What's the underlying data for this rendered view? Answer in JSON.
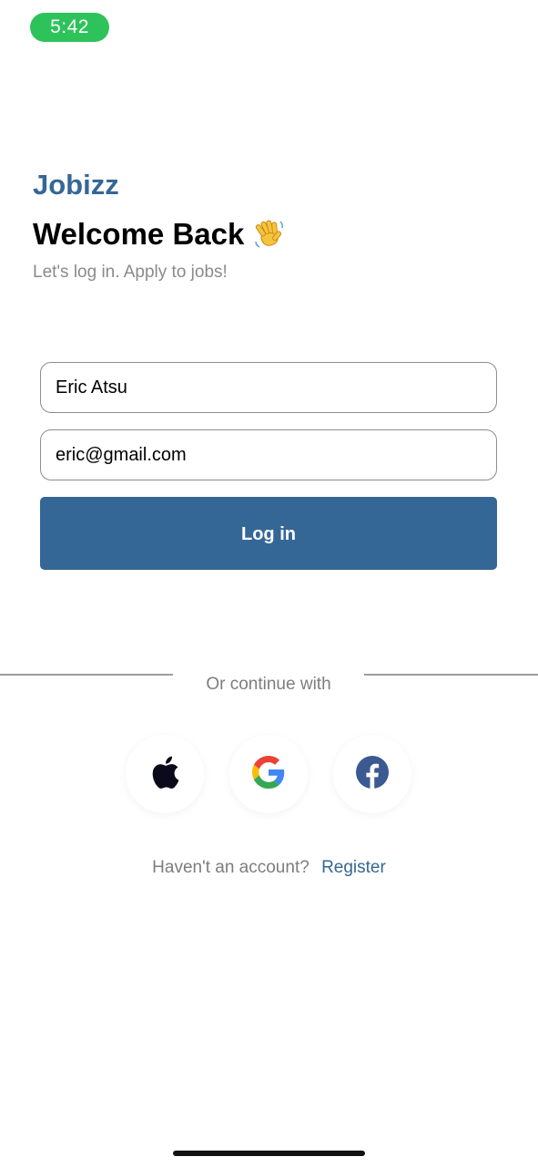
{
  "status_bar": {
    "time": "5:42",
    "pill_color": "#2ec35a"
  },
  "header": {
    "brand": "Jobizz",
    "title": "Welcome Back",
    "title_emoji": "waving-hand",
    "subtitle": "Let's log in. Apply to jobs!"
  },
  "form": {
    "name_value": "Eric Atsu",
    "email_value": "eric@gmail.com",
    "login_label": "Log in"
  },
  "divider": {
    "text": "Or continue with"
  },
  "social": [
    {
      "icon": "apple-icon"
    },
    {
      "icon": "google-icon"
    },
    {
      "icon": "facebook-icon"
    }
  ],
  "footer": {
    "question": "Haven't an account?",
    "register_label": "Register"
  },
  "colors": {
    "brand": "#356796",
    "muted_text": "#8a8a8a",
    "border": "#8d8d8d"
  }
}
